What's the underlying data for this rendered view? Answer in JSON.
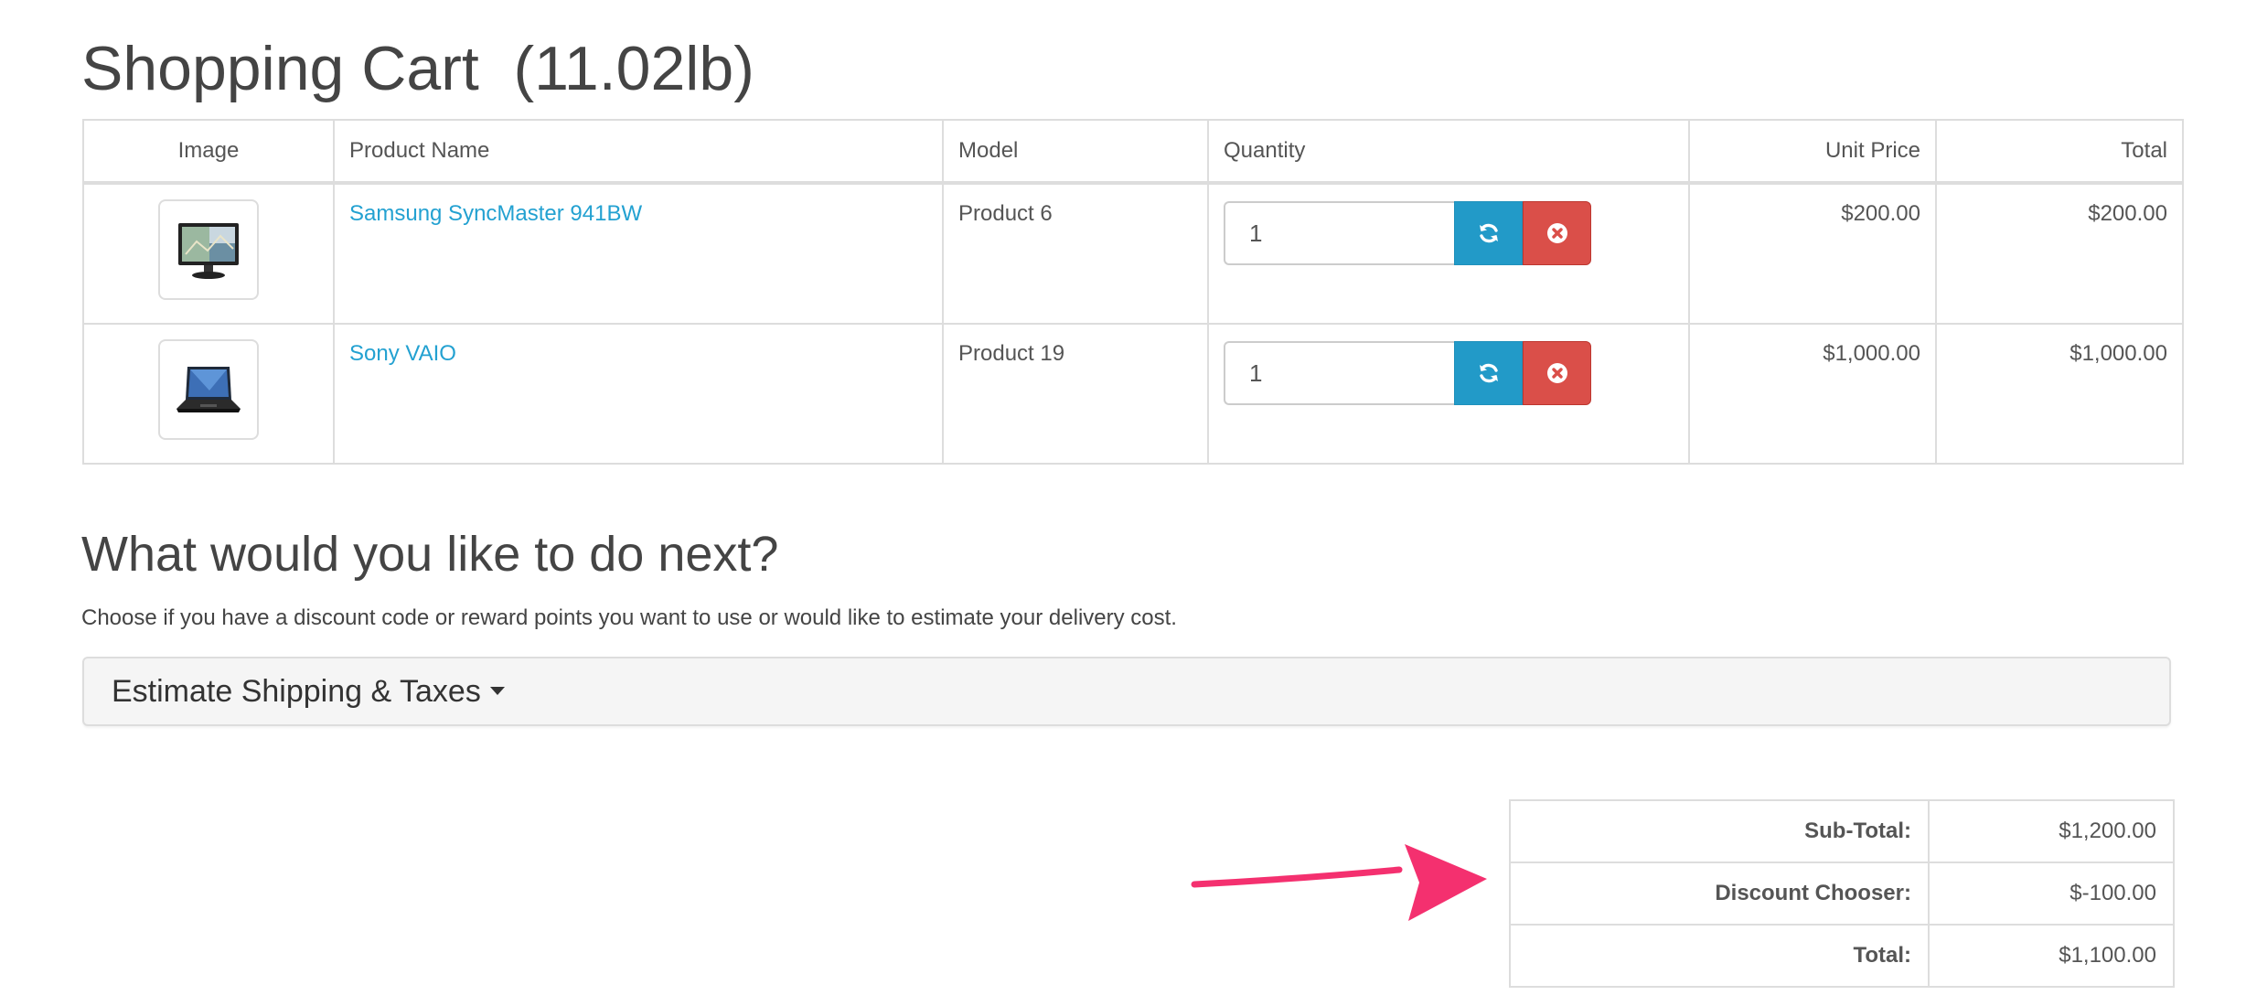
{
  "page": {
    "title": "Shopping Cart  (11.02lb)"
  },
  "cart": {
    "columns": {
      "image": "Image",
      "name": "Product Name",
      "model": "Model",
      "quantity": "Quantity",
      "unit_price": "Unit Price",
      "total": "Total"
    },
    "items": [
      {
        "name": "Samsung SyncMaster 941BW",
        "model": "Product 6",
        "quantity": "1",
        "unit_price": "$200.00",
        "total": "$200.00",
        "image_icon": "monitor-icon"
      },
      {
        "name": "Sony VAIO",
        "model": "Product 19",
        "quantity": "1",
        "unit_price": "$1,000.00",
        "total": "$1,000.00",
        "image_icon": "laptop-icon"
      }
    ],
    "icons": {
      "update": "refresh-icon",
      "remove": "remove-circle-icon"
    }
  },
  "next": {
    "title": "What would you like to do next?",
    "description": "Choose if you have a discount code or reward points you want to use or would like to estimate your delivery cost.",
    "shipping_label": "Estimate Shipping & Taxes"
  },
  "totals": [
    {
      "label": "Sub-Total:",
      "value": "$1,200.00"
    },
    {
      "label": "Discount Chooser:",
      "value": "$-100.00"
    },
    {
      "label": "Total:",
      "value": "$1,100.00"
    }
  ],
  "colors": {
    "link": "#23a1d1",
    "update_button": "#229ac8",
    "remove_button": "#da4f49",
    "annotation_arrow": "#f4306f"
  }
}
